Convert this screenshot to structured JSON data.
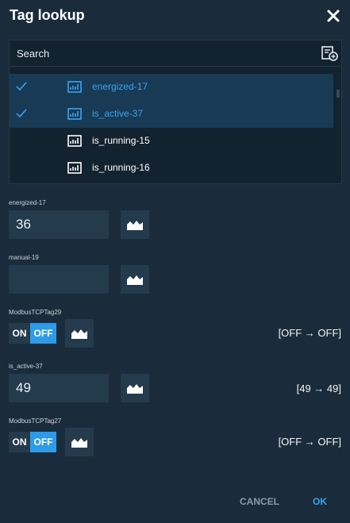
{
  "dialog": {
    "title": "Tag lookup"
  },
  "search": {
    "label": "Search"
  },
  "tag_list": [
    {
      "label": "energized-17",
      "selected": true
    },
    {
      "label": "is_active-37",
      "selected": true
    },
    {
      "label": "is_running-15",
      "selected": false
    },
    {
      "label": "is_running-16",
      "selected": false
    }
  ],
  "fields": [
    {
      "label": "energized-17",
      "kind": "number",
      "value": "36",
      "readout": ""
    },
    {
      "label": "manual-19",
      "kind": "number",
      "value": "",
      "readout": ""
    },
    {
      "label": "ModbusTCPTag29",
      "kind": "toggle",
      "on_label": "ON",
      "off_label": "OFF",
      "readout": "[OFF → OFF]"
    },
    {
      "label": "is_active-37",
      "kind": "number",
      "value": "49",
      "readout": "[49 → 49]"
    },
    {
      "label": "ModbusTCPTag27",
      "kind": "toggle",
      "on_label": "ON",
      "off_label": "OFF",
      "readout": "[OFF → OFF]"
    }
  ],
  "footer": {
    "cancel_label": "CANCEL",
    "ok_label": "OK"
  },
  "colors": {
    "accent": "#2e9be8",
    "background": "#1a2c3b",
    "input": "#243a4d"
  }
}
